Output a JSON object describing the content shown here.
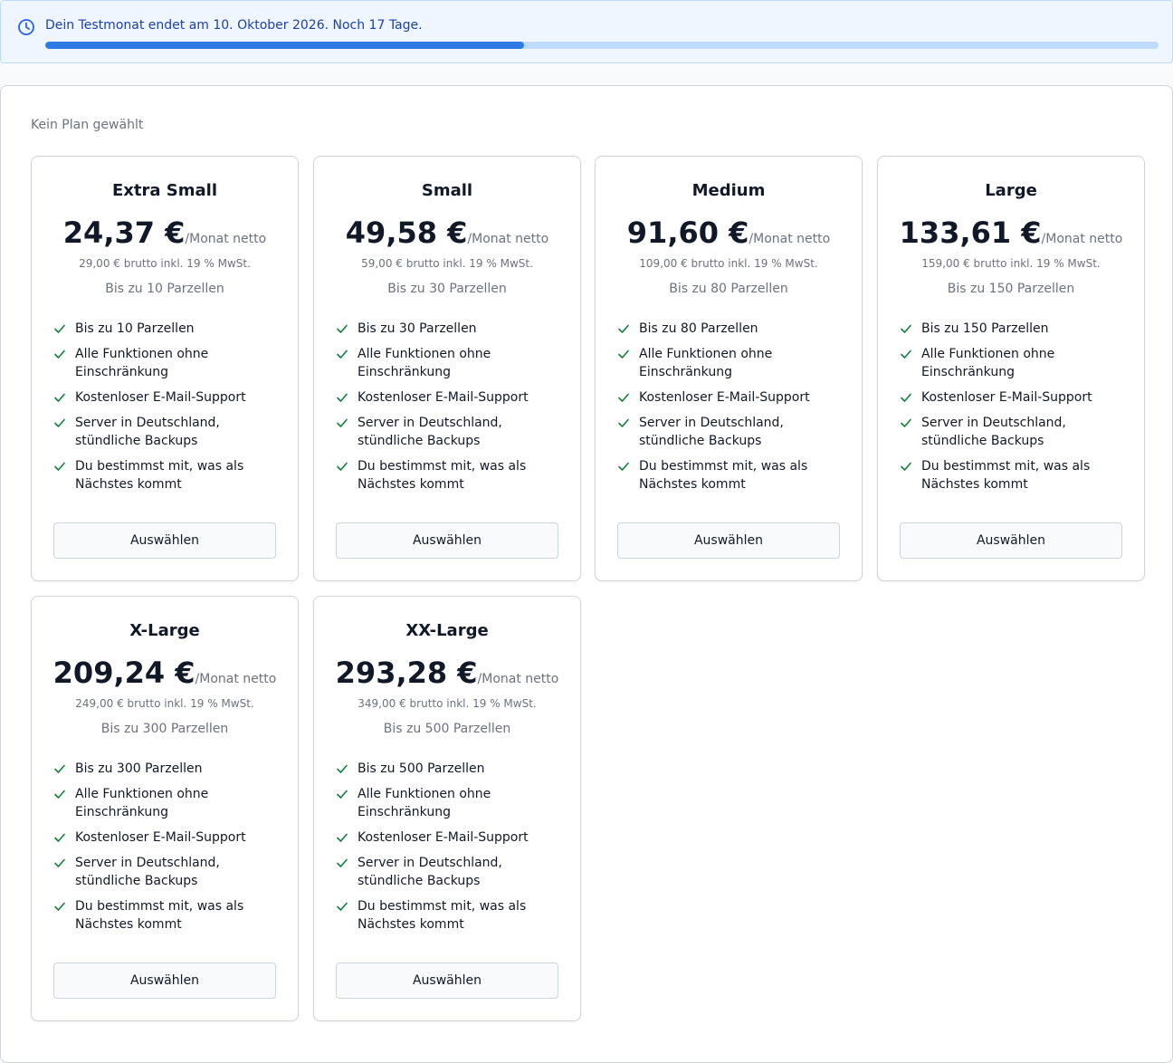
{
  "trial": {
    "text": "Dein Testmonat endet am 10. Oktober 2026. Noch 17 Tage.",
    "progress": 0.43,
    "accent": "#2f7ae5",
    "icon": "clock-icon"
  },
  "no_plan_label": "Kein Plan gewählt",
  "check_color": "#15803d",
  "plans": [
    {
      "name": "Extra Small",
      "price": "24,37 €",
      "per": "/Monat netto",
      "gross": "29,00 € brutto inkl. 19 % MwSt.",
      "limit": "Bis zu 10 Parzellen",
      "features": [
        "Bis zu 10 Parzellen",
        "Alle Funktionen ohne Einschränkung",
        "Kostenloser E-Mail-Support",
        "Server in Deutschland, stündliche Backups",
        "Du bestimmst mit, was als Nächstes kommt"
      ],
      "button": "Auswählen"
    },
    {
      "name": "Small",
      "price": "49,58 €",
      "per": "/Monat netto",
      "gross": "59,00 € brutto inkl. 19 % MwSt.",
      "limit": "Bis zu 30 Parzellen",
      "features": [
        "Bis zu 30 Parzellen",
        "Alle Funktionen ohne Einschränkung",
        "Kostenloser E-Mail-Support",
        "Server in Deutschland, stündliche Backups",
        "Du bestimmst mit, was als Nächstes kommt"
      ],
      "button": "Auswählen"
    },
    {
      "name": "Medium",
      "price": "91,60 €",
      "per": "/Monat netto",
      "gross": "109,00 € brutto inkl. 19 % MwSt.",
      "limit": "Bis zu 80 Parzellen",
      "features": [
        "Bis zu 80 Parzellen",
        "Alle Funktionen ohne Einschränkung",
        "Kostenloser E-Mail-Support",
        "Server in Deutschland, stündliche Backups",
        "Du bestimmst mit, was als Nächstes kommt"
      ],
      "button": "Auswählen"
    },
    {
      "name": "Large",
      "price": "133,61 €",
      "per": "/Monat netto",
      "gross": "159,00 € brutto inkl. 19 % MwSt.",
      "limit": "Bis zu 150 Parzellen",
      "features": [
        "Bis zu 150 Parzellen",
        "Alle Funktionen ohne Einschränkung",
        "Kostenloser E-Mail-Support",
        "Server in Deutschland, stündliche Backups",
        "Du bestimmst mit, was als Nächstes kommt"
      ],
      "button": "Auswählen"
    },
    {
      "name": "X-Large",
      "price": "209,24 €",
      "per": "/Monat netto",
      "gross": "249,00 € brutto inkl. 19 % MwSt.",
      "limit": "Bis zu 300 Parzellen",
      "features": [
        "Bis zu 300 Parzellen",
        "Alle Funktionen ohne Einschränkung",
        "Kostenloser E-Mail-Support",
        "Server in Deutschland, stündliche Backups",
        "Du bestimmst mit, was als Nächstes kommt"
      ],
      "button": "Auswählen"
    },
    {
      "name": "XX-Large",
      "price": "293,28 €",
      "per": "/Monat netto",
      "gross": "349,00 € brutto inkl. 19 % MwSt.",
      "limit": "Bis zu 500 Parzellen",
      "features": [
        "Bis zu 500 Parzellen",
        "Alle Funktionen ohne Einschränkung",
        "Kostenloser E-Mail-Support",
        "Server in Deutschland, stündliche Backups",
        "Du bestimmst mit, was als Nächstes kommt"
      ],
      "button": "Auswählen"
    }
  ]
}
